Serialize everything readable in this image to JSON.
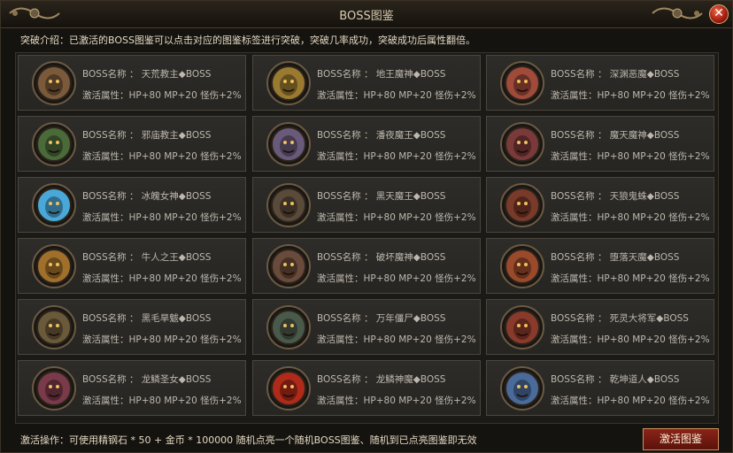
{
  "window": {
    "title": "BOSS图鉴"
  },
  "intro": "突破介绍：已激活的BOSS图鉴可以点击对应的图鉴标签进行突破，突破几率成功，突破成功后属性翻倍。",
  "colors": {
    "accent": "#8a2418",
    "panel": "#2e2c29",
    "text": "#bdb7ad"
  },
  "bosses": [
    {
      "name": "BOSS名称 ： 天荒教主◆BOSS",
      "attr": "激活属性：HP+80  MP+20  怪伤+2%",
      "icon": "demon-portrait-icon",
      "tint": "#7a5a3a"
    },
    {
      "name": "BOSS名称 ： 地王魔神◆BOSS",
      "attr": "激活属性：HP+80  MP+20  怪伤+2%",
      "icon": "beast-portrait-icon",
      "tint": "#9a7a30"
    },
    {
      "name": "BOSS名称 ： 深渊恶魔◆BOSS",
      "attr": "激活属性：HP+80  MP+20  怪伤+2%",
      "icon": "demon-portrait-icon",
      "tint": "#a04a3a"
    },
    {
      "name": "BOSS名称 ： 邪庙教主◆BOSS",
      "attr": "激活属性：HP+80  MP+20  怪伤+2%",
      "icon": "orc-portrait-icon",
      "tint": "#4a6a3a"
    },
    {
      "name": "BOSS名称 ： 潘夜魔王◆BOSS",
      "attr": "激活属性：HP+80  MP+20  怪伤+2%",
      "icon": "demon-portrait-icon",
      "tint": "#6a5a7a"
    },
    {
      "name": "BOSS名称 ： 魔天魔神◆BOSS",
      "attr": "激活属性：HP+80  MP+20  怪伤+2%",
      "icon": "horned-portrait-icon",
      "tint": "#7a3a3a"
    },
    {
      "name": "BOSS名称 ： 冰魄女神◆BOSS",
      "attr": "激活属性：HP+80  MP+20  怪伤+2%",
      "icon": "ice-goddess-portrait-icon",
      "tint": "#4aa8d8"
    },
    {
      "name": "BOSS名称 ： 黑天魔王◆BOSS",
      "attr": "激活属性：HP+80  MP+20  怪伤+2%",
      "icon": "knight-portrait-icon",
      "tint": "#5a4a3a"
    },
    {
      "name": "BOSS名称 ： 天狼鬼蛛◆BOSS",
      "attr": "激活属性：HP+80  MP+20  怪伤+2%",
      "icon": "spider-portrait-icon",
      "tint": "#7a3a2a"
    },
    {
      "name": "BOSS名称 ： 牛人之王◆BOSS",
      "attr": "激活属性：HP+80  MP+20  怪伤+2%",
      "icon": "bull-portrait-icon",
      "tint": "#a0702a"
    },
    {
      "name": "BOSS名称 ： 破坏魔神◆BOSS",
      "attr": "激活属性：HP+80  MP+20  怪伤+2%",
      "icon": "golem-portrait-icon",
      "tint": "#6a4a3a"
    },
    {
      "name": "BOSS名称 ： 堕落天魔◆BOSS",
      "attr": "激活属性：HP+80  MP+20  怪伤+2%",
      "icon": "demon-portrait-icon",
      "tint": "#9a4a2a"
    },
    {
      "name": "BOSS名称 ： 黑毛旱魃◆BOSS",
      "attr": "激活属性：HP+80  MP+20  怪伤+2%",
      "icon": "beast-portrait-icon",
      "tint": "#6a5a3a"
    },
    {
      "name": "BOSS名称 ： 万年僵尸◆BOSS",
      "attr": "激活属性：HP+80  MP+20  怪伤+2%",
      "icon": "zombie-portrait-icon",
      "tint": "#4a5a4a"
    },
    {
      "name": "BOSS名称 ： 死灵大将军◆BOSS",
      "attr": "激活属性：HP+80  MP+20  怪伤+2%",
      "icon": "general-portrait-icon",
      "tint": "#8a3a2a"
    },
    {
      "name": "BOSS名称 ： 龙鳞圣女◆BOSS",
      "attr": "激活属性：HP+80  MP+20  怪伤+2%",
      "icon": "dragon-portrait-icon",
      "tint": "#7a3a4a"
    },
    {
      "name": "BOSS名称 ： 龙鳞神魔◆BOSS",
      "attr": "激活属性：HP+80  MP+20  怪伤+2%",
      "icon": "dragon-portrait-icon",
      "tint": "#b02a1a"
    },
    {
      "name": "BOSS名称 ： 乾坤道人◆BOSS",
      "attr": "激活属性：HP+80  MP+20  怪伤+2%",
      "icon": "taoist-portrait-icon",
      "tint": "#4a6a9a"
    }
  ],
  "footer": {
    "text": "激活操作：可使用精钢石 * 50 + 金币 * 100000 随机点亮一个随机BOSS图鉴、随机到已点亮图鉴即无效",
    "button_label": "激活图鉴"
  }
}
